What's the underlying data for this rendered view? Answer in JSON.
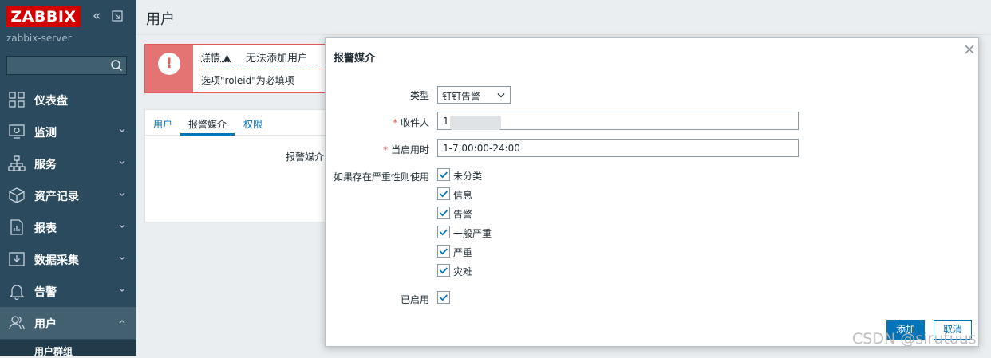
{
  "brand": {
    "logo": "ZABBIX",
    "server": "zabbix-server"
  },
  "search": {
    "value": ""
  },
  "sidebar": {
    "items": [
      {
        "label": "仪表盘",
        "icon": "dashboard-icon"
      },
      {
        "label": "监测",
        "icon": "monitoring-icon"
      },
      {
        "label": "服务",
        "icon": "services-icon"
      },
      {
        "label": "资产记录",
        "icon": "inventory-icon"
      },
      {
        "label": "报表",
        "icon": "reports-icon"
      },
      {
        "label": "数据采集",
        "icon": "data-collection-icon"
      },
      {
        "label": "告警",
        "icon": "bell-icon"
      },
      {
        "label": "用户",
        "icon": "users-icon"
      }
    ],
    "active_sub": "用户群组"
  },
  "page": {
    "title": "用户"
  },
  "message": {
    "details_label": "详情 ▲",
    "title": "无法添加用户",
    "text": "选项\"roleid\"为必填项"
  },
  "tabs": [
    "用户",
    "报警媒介",
    "权限"
  ],
  "tab_content_label": "报警媒介",
  "modal": {
    "title": "报警媒介",
    "type_label": "类型",
    "type_value": "钉钉告警",
    "sendto_label": "收件人",
    "sendto_value": "1",
    "period_label": "当启用时",
    "period_value": "1-7,00:00-24:00",
    "severity_label": "如果存在严重性则使用",
    "severities": [
      "未分类",
      "信息",
      "告警",
      "一般严重",
      "严重",
      "灾难"
    ],
    "enabled_label": "已启用",
    "add_button": "添加",
    "cancel_button": "取消"
  },
  "watermark": "CSDN @sirutuus",
  "colors": {
    "sidebar": "#2b4a5e",
    "accent": "#0275b8",
    "error": "#e45959",
    "logo": "#d40000"
  }
}
